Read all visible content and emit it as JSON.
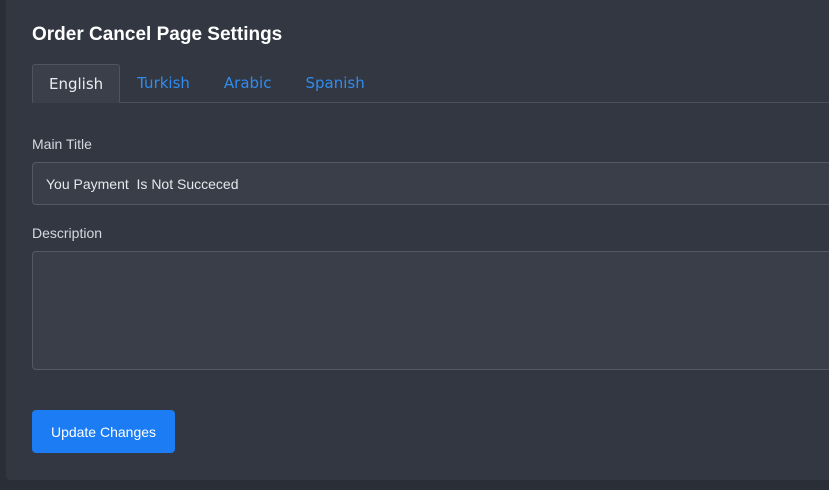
{
  "page": {
    "title": "Order Cancel Page Settings"
  },
  "tabs": [
    {
      "label": "English",
      "active": true
    },
    {
      "label": "Turkish",
      "active": false
    },
    {
      "label": "Arabic",
      "active": false
    },
    {
      "label": "Spanish",
      "active": false
    }
  ],
  "form": {
    "main_title_label": "Main Title",
    "main_title_value": "You Payment  Is Not Succeced",
    "description_label": "Description",
    "description_value": "",
    "submit_label": "Update Changes"
  },
  "colors": {
    "accent": "#1b7cf3",
    "tab_link": "#2f8cf0",
    "background": "#2a2e36",
    "card": "#323741"
  }
}
